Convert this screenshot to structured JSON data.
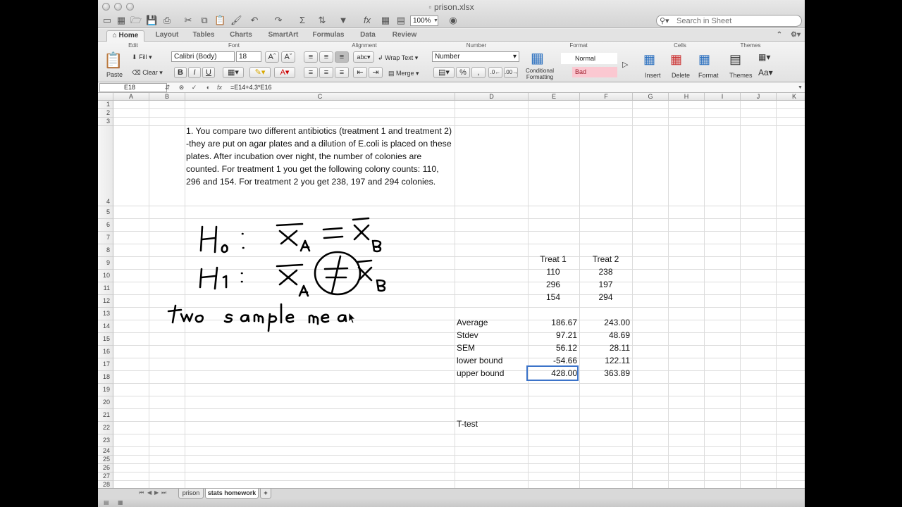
{
  "window": {
    "title": "prison.xlsx"
  },
  "toolbar": {
    "zoom": "100%",
    "search_placeholder": "Search in Sheet"
  },
  "ribbon_tabs": [
    "Home",
    "Layout",
    "Tables",
    "Charts",
    "SmartArt",
    "Formulas",
    "Data",
    "Review"
  ],
  "ribbon": {
    "groups": [
      "Edit",
      "Font",
      "Alignment",
      "Number",
      "Format",
      "Cells",
      "Themes"
    ],
    "paste": "Paste",
    "fill": "Fill",
    "clear": "Clear",
    "font_name": "Calibri (Body)",
    "font_size": "18",
    "bold": "B",
    "italic": "I",
    "underline": "U",
    "wrap_text": "Wrap Text",
    "merge": "Merge",
    "number_format": "Number",
    "conditional_formatting": "Conditional Formatting",
    "style_normal": "Normal",
    "style_bad": "Bad",
    "insert": "Insert",
    "delete": "Delete",
    "format": "Format",
    "themes": "Themes"
  },
  "formula_bar": {
    "cell": "E18",
    "formula": "=E14+4.3*E16"
  },
  "columns": [
    "A",
    "B",
    "C",
    "D",
    "E",
    "F",
    "G",
    "H",
    "I",
    "J",
    "K"
  ],
  "rows": [
    "1",
    "2",
    "3",
    "4",
    "5",
    "6",
    "7",
    "8",
    "9",
    "10",
    "11",
    "12",
    "13",
    "14",
    "15",
    "16",
    "17",
    "18",
    "19",
    "20",
    "21",
    "22",
    "23",
    "24",
    "25",
    "26",
    "27",
    "28"
  ],
  "sheet": {
    "problem_text": "1. You compare two different antibiotics (treatment 1 and treatment 2) -they are put on agar plates and a dilution of E.coli is placed on these plates. After incubation over night, the number of colonies are counted. For treatment 1 you get the following colony counts: 110, 296 and 154. For treatment 2 you get 238, 197 and 294 colonies.",
    "headers": [
      "Treat 1",
      "Treat 2"
    ],
    "data": [
      [
        "110",
        "238"
      ],
      [
        "296",
        "197"
      ],
      [
        "154",
        "294"
      ]
    ],
    "stats": [
      {
        "label": "Average",
        "t1": "186.67",
        "t2": "243.00"
      },
      {
        "label": "Stdev",
        "t1": "97.21",
        "t2": "48.69"
      },
      {
        "label": "SEM",
        "t1": "56.12",
        "t2": "28.11"
      },
      {
        "label": "lower bound",
        "t1": "-54.66",
        "t2": "122.11"
      },
      {
        "label": "upper bound",
        "t1": "428.00",
        "t2": "363.89"
      }
    ],
    "ttest_label": "T-test"
  },
  "sheet_tabs": [
    "prison",
    "stats homework"
  ]
}
